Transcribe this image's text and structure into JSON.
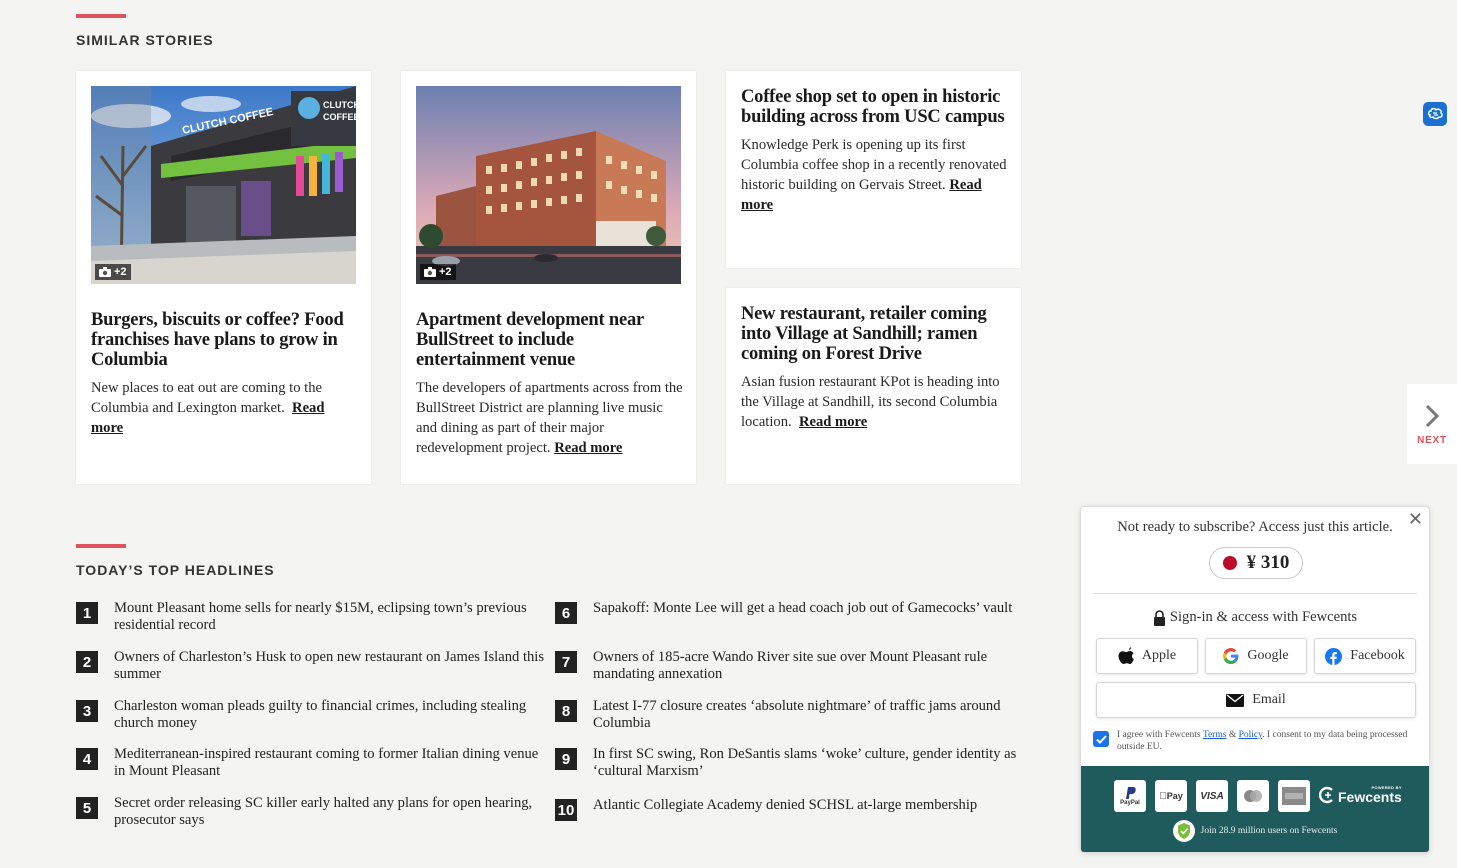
{
  "similar_stories": {
    "heading": "SIMILAR STORIES",
    "cards": [
      {
        "title": "Burgers, biscuits or coffee? Food franchises have plans to grow in Columbia",
        "text": "New places to eat out are coming to the Columbia and Lexington market.",
        "read_more": "Read more",
        "photo_count": "+2",
        "sign_text": "CLUTCH COFFEE"
      },
      {
        "title": "Apartment development near BullStreet to include entertainment venue",
        "text": "The developers of apartments across from the BullStreet District are planning live music and dining as part of their major redevelopment project.",
        "read_more": "Read more",
        "photo_count": "+2"
      },
      {
        "title": "Coffee shop set to open in historic building across from USC campus",
        "text": "Knowledge Perk is opening up its first Columbia coffee shop in a recently renovated historic building on Gervais Street.",
        "read_more": "Read more"
      },
      {
        "title": "New restaurant, retailer coming into Village at Sandhill; ramen coming on Forest Drive",
        "text": "Asian fusion restaurant KPot is heading into the Village at Sandhill, its second Columbia location.",
        "read_more": "Read more"
      }
    ]
  },
  "top_headlines": {
    "heading": "TODAY’S TOP HEADLINES",
    "items": [
      {
        "num": "1",
        "text": "Mount Pleasant home sells for nearly $15M, eclipsing town’s previous residential record"
      },
      {
        "num": "2",
        "text": "Owners of Charleston’s Husk to open new restaurant on James Island this summer"
      },
      {
        "num": "3",
        "text": "Charleston woman pleads guilty to financial crimes, including stealing church money"
      },
      {
        "num": "4",
        "text": "Mediterranean-inspired restaurant coming to former Italian dining venue in Mount Pleasant"
      },
      {
        "num": "5",
        "text": "Secret order releasing SC killer early halted any plans for open hearing, prosecutor says"
      },
      {
        "num": "6",
        "text": "Sapakoff: Monte Lee will get a head coach job out of Gamecocks’ vault"
      },
      {
        "num": "7",
        "text": "Owners of 185-acre Wando River site sue over Mount Pleasant rule mandating annexation"
      },
      {
        "num": "8",
        "text": "Latest I-77 closure creates ‘absolute nightmare’ of traffic jams around Columbia"
      },
      {
        "num": "9",
        "text": "In first SC swing, Ron DeSantis slams ‘woke’ culture, gender identity as ‘cultural Marxism’"
      },
      {
        "num": "10",
        "text": "Atlantic Collegiate Academy denied SCHSL at-large membership"
      }
    ]
  },
  "next": {
    "label": "NEXT"
  },
  "fewcents": {
    "lead": "Not ready to subscribe? Access just this article.",
    "price": "¥ 310",
    "signin": "Sign-in & access with Fewcents",
    "buttons": {
      "apple": "Apple",
      "google": "Google",
      "facebook": "Facebook",
      "email": "Email"
    },
    "consent_pre": "I agree with Fewcents ",
    "terms": "Terms",
    "amp": " & ",
    "policy": "Policy",
    "consent_post": ". I consent to my data being processed outside EU.",
    "payments": [
      "PayPal",
      "Pay",
      "VISA",
      "",
      ""
    ],
    "powered_by": "POWERED BY",
    "brand": "Fewcents",
    "join": "Join 28.9 million users on Fewcents",
    "colors": {
      "footer": "#1f5a5c",
      "accent": "#e0535b",
      "price_dot": "#bd0b2b"
    }
  }
}
